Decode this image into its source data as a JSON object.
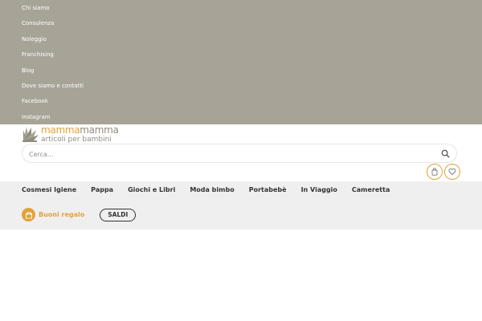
{
  "top_menu": {
    "items": [
      {
        "label": "Chi siamo"
      },
      {
        "label": "Consulenza"
      },
      {
        "label": "Noleggio"
      },
      {
        "label": "Franchising"
      },
      {
        "label": "Blog"
      },
      {
        "label": "Dove siamo e contatti"
      },
      {
        "label": "Facebook"
      },
      {
        "label": "Instagram"
      }
    ]
  },
  "logo": {
    "name_part1": "mamma",
    "name_part2": "mamma",
    "tagline": "articoli per bambini"
  },
  "search": {
    "placeholder": "Cerca..."
  },
  "categories": [
    {
      "label": "Cosmesi Igiene"
    },
    {
      "label": "Pappa"
    },
    {
      "label": "Giochi e Libri"
    },
    {
      "label": "Moda bimbo"
    },
    {
      "label": "Portabebè"
    },
    {
      "label": "In Viaggio"
    },
    {
      "label": "Cameretta"
    }
  ],
  "promo": {
    "gift_label": "Buoni regalo",
    "saldi_label": "SALDI"
  },
  "colors": {
    "menu_bg": "#a7a497",
    "accent": "#e3a13a",
    "nav_bg": "#efefef"
  },
  "icons": {
    "search": "search-icon",
    "cart": "shopping-bag-icon",
    "wishlist": "heart-icon",
    "gift": "gift-icon"
  }
}
